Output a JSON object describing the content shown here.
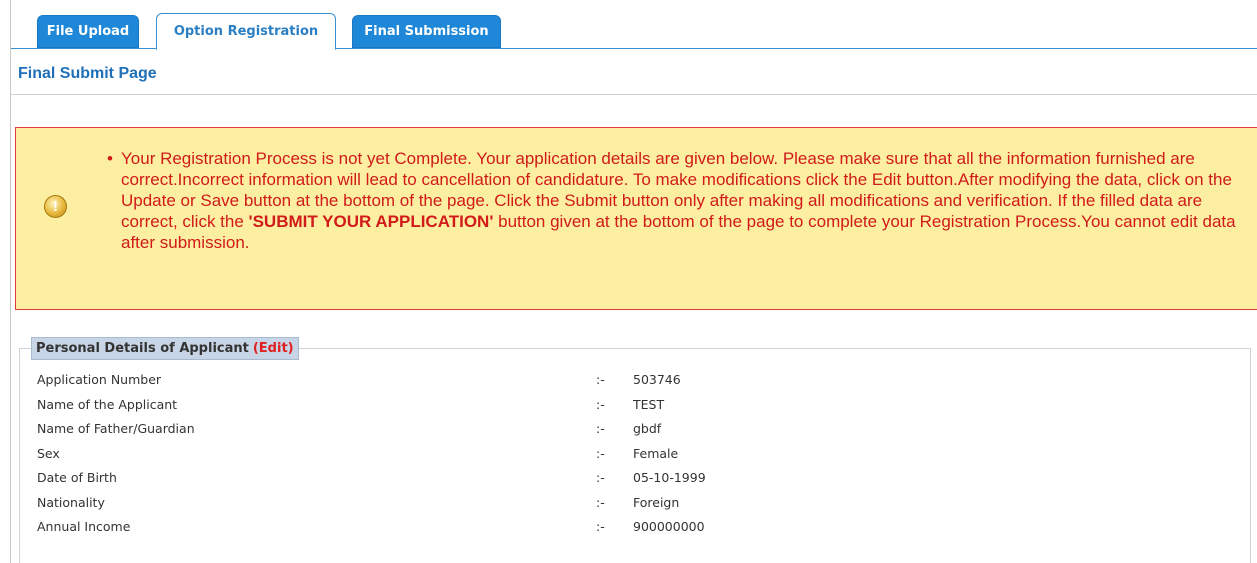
{
  "tabs": [
    {
      "label": "File Upload"
    },
    {
      "label": "Option Registration"
    },
    {
      "label": "Final Submission"
    }
  ],
  "page": {
    "title": "Final Submit Page"
  },
  "alert": {
    "text_before": "Your Registration Process is not yet Complete. Your application details are given below. Please make sure that all the information furnished are correct.Incorrect information will lead to cancellation of candidature. To make modifications click the Edit button.After modifying the data, click on the Update or Save button at the bottom of the page. Click the Submit button only after making all modifications and verification. If the filled data are correct, click the ",
    "bold_text": "'SUBMIT YOUR APPLICATION'",
    "text_after": " button given at the bottom of the page to complete your Registration Process.You cannot edit data after submission.",
    "icon": "warning-icon",
    "icon_glyph": "!"
  },
  "personal": {
    "legend": "Personal Details of Applicant",
    "edit_label": "(Edit)",
    "separator": ":-",
    "rows": [
      {
        "label": "Application Number",
        "value": "503746"
      },
      {
        "label": "Name of the Applicant",
        "value": "TEST"
      },
      {
        "label": "Name of Father/Guardian",
        "value": "gbdf"
      },
      {
        "label": "Sex",
        "value": "Female"
      },
      {
        "label": "Date of Birth",
        "value": "05-10-1999"
      },
      {
        "label": "Nationality",
        "value": "Foreign"
      },
      {
        "label": "Annual Income",
        "value": "900000000"
      }
    ]
  },
  "colors": {
    "tab_blue": "#1f87d7",
    "alert_bg": "#fcefa1",
    "alert_text": "#d11a1a",
    "title_blue": "#1f70b8"
  }
}
